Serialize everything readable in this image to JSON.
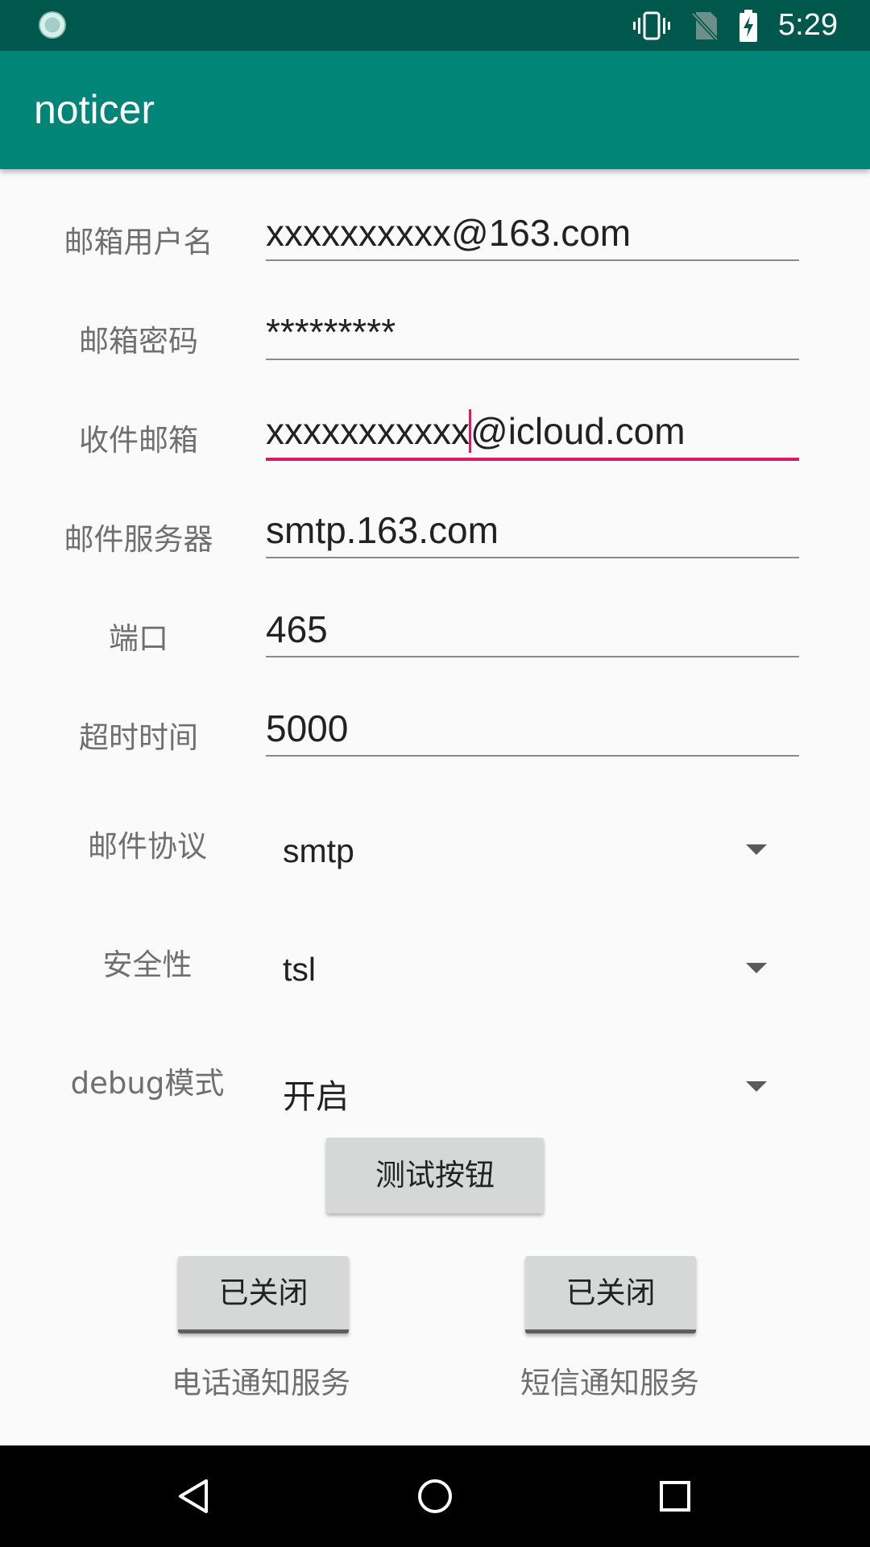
{
  "status_bar": {
    "time": "5:29"
  },
  "app": {
    "title": "noticer"
  },
  "fields": [
    {
      "label": "邮箱用户名",
      "value": "xxxxxxxxxx@163.com"
    },
    {
      "label": "邮箱密码",
      "value": "*********"
    },
    {
      "label": "收件邮箱",
      "value_before_cursor": "xxxxxxxxxxx",
      "value_after_cursor": "@icloud.com"
    },
    {
      "label": "邮件服务器",
      "value": "smtp.163.com"
    },
    {
      "label": "端口",
      "value": "465"
    },
    {
      "label": "超时时间",
      "value": "5000"
    }
  ],
  "spinners": [
    {
      "label": "邮件协议",
      "value": "smtp"
    },
    {
      "label": "安全性",
      "value": "tsl"
    },
    {
      "label": "debug模式",
      "value": "开启"
    }
  ],
  "test_button": {
    "label": "测试按钮"
  },
  "services": [
    {
      "button_label": "已关闭",
      "caption": "电话通知服务"
    },
    {
      "button_label": "已关闭",
      "caption": "短信通知服务"
    }
  ]
}
